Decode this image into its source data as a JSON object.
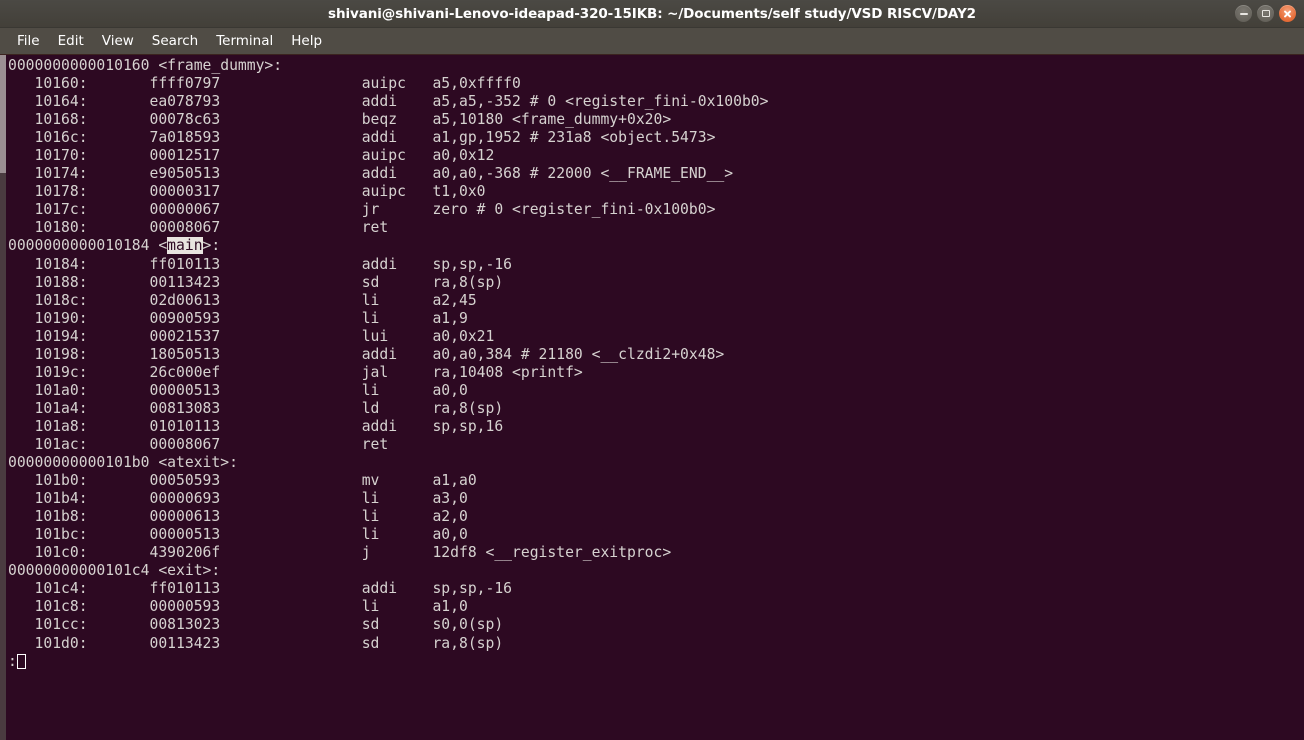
{
  "window": {
    "title": "shivani@shivani-Lenovo-ideapad-320-15IKB: ~/Documents/self study/VSD RISCV/DAY2",
    "controls": {
      "minimize_label": "Minimize",
      "maximize_label": "Maximize",
      "close_label": "Close"
    },
    "colors": {
      "titlebar": "#46443f",
      "menubar": "#504c45",
      "terminal_bg": "#2d0922",
      "terminal_fg": "#d6d2d0",
      "close_button": "#e8703c",
      "highlight_bg": "#e8e4df"
    }
  },
  "menubar": {
    "items": [
      {
        "label": "File"
      },
      {
        "label": "Edit"
      },
      {
        "label": "View"
      },
      {
        "label": "Search"
      },
      {
        "label": "Terminal"
      },
      {
        "label": "Help"
      }
    ]
  },
  "terminal": {
    "scrollbar": {
      "thumb_position": "top"
    },
    "lines": [
      {
        "text": "0000000000010160 <frame_dummy>:"
      },
      {
        "text": "   10160:\tffff0797          \tauipc\ta5,0xffff0"
      },
      {
        "text": "   10164:\tea078793          \taddi\ta5,a5,-352 # 0 <register_fini-0x100b0>"
      },
      {
        "text": "   10168:\t00078c63          \tbeqz\ta5,10180 <frame_dummy+0x20>"
      },
      {
        "text": "   1016c:\t7a018593          \taddi\ta1,gp,1952 # 231a8 <object.5473>"
      },
      {
        "text": "   10170:\t00012517          \tauipc\ta0,0x12"
      },
      {
        "text": "   10174:\te9050513          \taddi\ta0,a0,-368 # 22000 <__FRAME_END__>"
      },
      {
        "text": "   10178:\t00000317          \tauipc\tt1,0x0"
      },
      {
        "text": "   1017c:\t00000067          \tjr\tzero # 0 <register_fini-0x100b0>"
      },
      {
        "text": "   10180:\t00008067          \tret"
      },
      {
        "text": ""
      },
      {
        "text": "0000000000010184 <main>:",
        "highlight": "main"
      },
      {
        "text": "   10184:\tff010113          \taddi\tsp,sp,-16"
      },
      {
        "text": "   10188:\t00113423          \tsd\tra,8(sp)"
      },
      {
        "text": "   1018c:\t02d00613          \tli\ta2,45"
      },
      {
        "text": "   10190:\t00900593          \tli\ta1,9"
      },
      {
        "text": "   10194:\t00021537          \tlui\ta0,0x21"
      },
      {
        "text": "   10198:\t18050513          \taddi\ta0,a0,384 # 21180 <__clzdi2+0x48>"
      },
      {
        "text": "   1019c:\t26c000ef          \tjal\tra,10408 <printf>"
      },
      {
        "text": "   101a0:\t00000513          \tli\ta0,0"
      },
      {
        "text": "   101a4:\t00813083          \tld\tra,8(sp)"
      },
      {
        "text": "   101a8:\t01010113          \taddi\tsp,sp,16"
      },
      {
        "text": "   101ac:\t00008067          \tret"
      },
      {
        "text": ""
      },
      {
        "text": "00000000000101b0 <atexit>:"
      },
      {
        "text": "   101b0:\t00050593          \tmv\ta1,a0"
      },
      {
        "text": "   101b4:\t00000693          \tli\ta3,0"
      },
      {
        "text": "   101b8:\t00000613          \tli\ta2,0"
      },
      {
        "text": "   101bc:\t00000513          \tli\ta0,0"
      },
      {
        "text": "   101c0:\t4390206f          \tj\t12df8 <__register_exitproc>"
      },
      {
        "text": ""
      },
      {
        "text": "00000000000101c4 <exit>:"
      },
      {
        "text": "   101c4:\tff010113          \taddi\tsp,sp,-16"
      },
      {
        "text": "   101c8:\t00000593          \tli\ta1,0"
      },
      {
        "text": "   101cc:\t00813023          \tsd\ts0,0(sp)"
      },
      {
        "text": "   101d0:\t00113423          \tsd\tra,8(sp)"
      }
    ],
    "prompt": {
      "text": ":",
      "cursor": "block"
    }
  }
}
